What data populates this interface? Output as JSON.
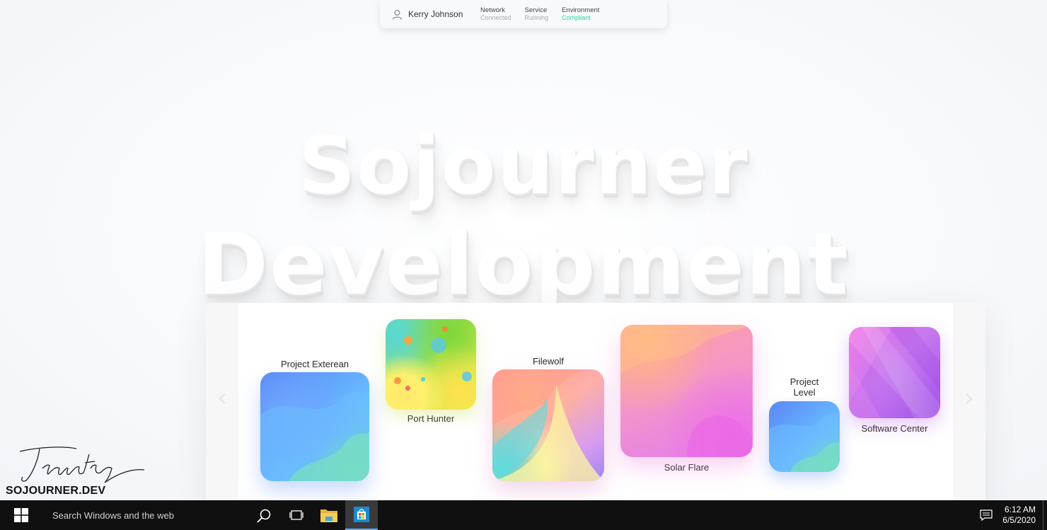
{
  "status_bar": {
    "user_name": "Kerry Johnson",
    "items": [
      {
        "label": "Network",
        "value": "Connected"
      },
      {
        "label": "Service",
        "value": "Running"
      },
      {
        "label": "Environment",
        "value": "Compliant"
      }
    ]
  },
  "hero": {
    "line1": "Sojourner",
    "line2": "Development"
  },
  "carousel": {
    "prev_icon": "‹",
    "next_icon": "›",
    "apps": [
      {
        "name": "Project Exterean"
      },
      {
        "name": "Port Hunter"
      },
      {
        "name": "Filewolf"
      },
      {
        "name": "Solar Flare"
      },
      {
        "name": "Project\nLevel"
      },
      {
        "name": "Software Center"
      }
    ]
  },
  "branding": {
    "signature": "Trinity",
    "domain": "SOJOURNER.DEV"
  },
  "taskbar": {
    "search_placeholder": "Search Windows and the web",
    "time": "6:12 AM",
    "date": "6/5/2020"
  },
  "colors": {
    "compliant": "#27d3a8",
    "taskbar": "#101010",
    "active_task_underline": "#6aa9e6"
  }
}
